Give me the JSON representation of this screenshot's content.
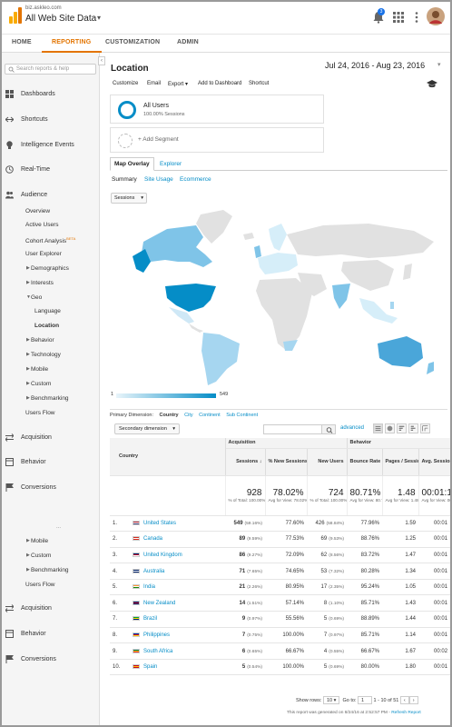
{
  "account": {
    "domain": "biz.askleo.com",
    "property": "All Web Site Data"
  },
  "nav": {
    "tabs": [
      "HOME",
      "REPORTING",
      "CUSTOMIZATION",
      "ADMIN"
    ],
    "active": "REPORTING"
  },
  "notifications": {
    "count": "3"
  },
  "sidebar": {
    "search_placeholder": "Search reports & help",
    "sections": [
      "Dashboards",
      "Shortcuts",
      "Intelligence Events",
      "Real-Time",
      "Audience"
    ],
    "audience_items": [
      "Overview",
      "Active Users",
      "Cohort Analysis",
      "User Explorer"
    ],
    "beta": "BETA",
    "audience_groups": [
      "Demographics",
      "Interests",
      "Geo"
    ],
    "geo_items": [
      "Language",
      "Location"
    ],
    "audience_groups2": [
      "Behavior",
      "Technology",
      "Mobile",
      "Custom",
      "Benchmarking"
    ],
    "users_flow": "Users Flow",
    "sections2": [
      "Acquisition",
      "Behavior",
      "Conversions"
    ],
    "ellipsis": "...",
    "lower_items": [
      "Mobile",
      "Custom",
      "Benchmarking"
    ],
    "lower_users_flow": "Users Flow",
    "sections3": [
      "Acquisition",
      "Behavior",
      "Conversions"
    ]
  },
  "page": {
    "title": "Location",
    "date_range": "Jul 24, 2016 - Aug 23, 2016"
  },
  "toolbar": [
    "Customize",
    "Email",
    "Export ▾",
    "Add to Dashboard",
    "Shortcut"
  ],
  "segment": {
    "name": "All Users",
    "sub": "100.00% Sessions",
    "add_label": "+ Add Segment"
  },
  "view_tabs": [
    "Map Overlay",
    "Explorer"
  ],
  "sub_tabs": [
    "Summary",
    "Site Usage",
    "Ecommerce"
  ],
  "metric_dropdown": "Sessions",
  "legend": {
    "min": "1",
    "max": "549"
  },
  "primary_dimension": {
    "label": "Primary Dimension:",
    "options": [
      "Country",
      "City",
      "Continent",
      "Sub Continent"
    ]
  },
  "secondary_dimension": "Secondary dimension",
  "advanced_label": "advanced",
  "table": {
    "group_headers": {
      "acquisition": "Acquisition",
      "behavior": "Behavior"
    },
    "columns": [
      "Country",
      "Sessions",
      "% New Sessions",
      "New Users",
      "Bounce Rate",
      "Pages / Session",
      "Avg. Session Duration"
    ],
    "totals": [
      {
        "big": "928",
        "sm": "% of Total: 100.00% (928)"
      },
      {
        "big": "78.02%",
        "sm": "Avg for View: 78.02% (0.00%)"
      },
      {
        "big": "724",
        "sm": "% of Total: 100.00% (724)"
      },
      {
        "big": "80.71%",
        "sm": "Avg for View: 80.71% (0.00%)"
      },
      {
        "big": "1.48",
        "sm": "Avg for View: 1.48 (0.00%)"
      },
      {
        "big": "00:01:1",
        "sm": "Avg for View: 00:01:1 (0.00%)"
      }
    ],
    "rows": [
      {
        "n": "1.",
        "country": "United States",
        "sessions": "549",
        "s_pct": "(59.16%)",
        "new_pct": "77.60%",
        "new_users": "426",
        "nu_pct": "(58.84%)",
        "bounce": "77.96%",
        "pages": "1.59",
        "dur": "00:01"
      },
      {
        "n": "2.",
        "country": "Canada",
        "sessions": "89",
        "s_pct": "(9.59%)",
        "new_pct": "77.53%",
        "new_users": "69",
        "nu_pct": "(9.53%)",
        "bounce": "88.76%",
        "pages": "1.25",
        "dur": "00:01"
      },
      {
        "n": "3.",
        "country": "United Kingdom",
        "sessions": "86",
        "s_pct": "(9.27%)",
        "new_pct": "72.09%",
        "new_users": "62",
        "nu_pct": "(8.56%)",
        "bounce": "83.72%",
        "pages": "1.47",
        "dur": "00:01"
      },
      {
        "n": "4.",
        "country": "Australia",
        "sessions": "71",
        "s_pct": "(7.65%)",
        "new_pct": "74.65%",
        "new_users": "53",
        "nu_pct": "(7.32%)",
        "bounce": "80.28%",
        "pages": "1.34",
        "dur": "00:01"
      },
      {
        "n": "5.",
        "country": "India",
        "sessions": "21",
        "s_pct": "(2.26%)",
        "new_pct": "80.95%",
        "new_users": "17",
        "nu_pct": "(2.35%)",
        "bounce": "95.24%",
        "pages": "1.05",
        "dur": "00:01"
      },
      {
        "n": "6.",
        "country": "New Zealand",
        "sessions": "14",
        "s_pct": "(1.51%)",
        "new_pct": "57.14%",
        "new_users": "8",
        "nu_pct": "(1.10%)",
        "bounce": "85.71%",
        "pages": "1.43",
        "dur": "00:01"
      },
      {
        "n": "7.",
        "country": "Brazil",
        "sessions": "9",
        "s_pct": "(0.97%)",
        "new_pct": "55.56%",
        "new_users": "5",
        "nu_pct": "(0.69%)",
        "bounce": "88.89%",
        "pages": "1.44",
        "dur": "00:01"
      },
      {
        "n": "8.",
        "country": "Philippines",
        "sessions": "7",
        "s_pct": "(0.75%)",
        "new_pct": "100.00%",
        "new_users": "7",
        "nu_pct": "(0.97%)",
        "bounce": "85.71%",
        "pages": "1.14",
        "dur": "00:01"
      },
      {
        "n": "9.",
        "country": "South Africa",
        "sessions": "6",
        "s_pct": "(0.65%)",
        "new_pct": "66.67%",
        "new_users": "4",
        "nu_pct": "(0.55%)",
        "bounce": "66.67%",
        "pages": "1.67",
        "dur": "00:02"
      },
      {
        "n": "10.",
        "country": "Spain",
        "sessions": "5",
        "s_pct": "(0.54%)",
        "new_pct": "100.00%",
        "new_users": "5",
        "nu_pct": "(0.69%)",
        "bounce": "80.00%",
        "pages": "1.80",
        "dur": "00:01"
      }
    ]
  },
  "pager": {
    "show_rows_label": "Show rows:",
    "rows": "10",
    "goto_label": "Go to:",
    "goto": "1",
    "range": "1 - 10 of 51"
  },
  "report_generated": "This report was generated on 8/24/16 at 2:52:57 PM -",
  "refresh": "Refresh Report",
  "colors": {
    "accent": "#e37400",
    "link": "#058dc7"
  }
}
